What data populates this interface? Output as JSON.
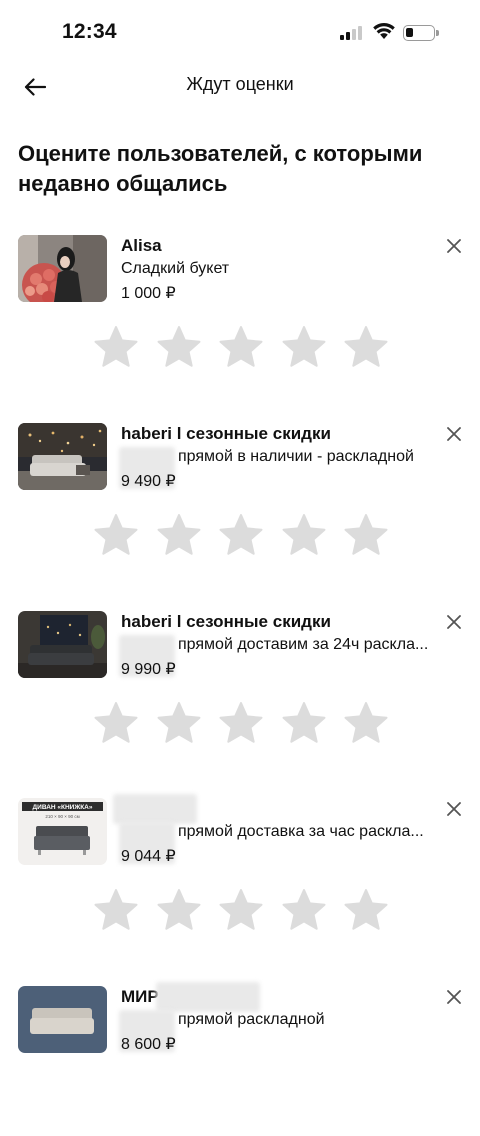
{
  "status_bar": {
    "time": "12:34"
  },
  "nav": {
    "title": "Ждут оценки"
  },
  "heading": "Оцените пользователей, с которыми недавно общались",
  "reviews": [
    {
      "seller": "Alisa",
      "title": "Сладкий букет",
      "price": "1 000 ₽",
      "rating": 0
    },
    {
      "seller": "haberi l сезонные скидки",
      "title": "прямой в наличии - раскладной",
      "price": "9 490 ₽",
      "rating": 0
    },
    {
      "seller": "haberi l сезонные скидки",
      "title": "прямой доставим за 24ч раскла...",
      "price": "9 990 ₽",
      "rating": 0
    },
    {
      "seller": "",
      "title": "прямой доставка за час раскла...",
      "price": "9 044 ₽",
      "rating": 0,
      "thumb_caption": "ДИВАН «КНИЖКА»",
      "thumb_subcaption": "210 × 90 × 90 см"
    },
    {
      "seller": "МИР",
      "title": "прямой раскладной",
      "price": "8 600 ₽",
      "rating": 0
    }
  ],
  "colors": {
    "star_empty": "#dcdcdc",
    "text": "#111111",
    "icon": "#555555"
  }
}
